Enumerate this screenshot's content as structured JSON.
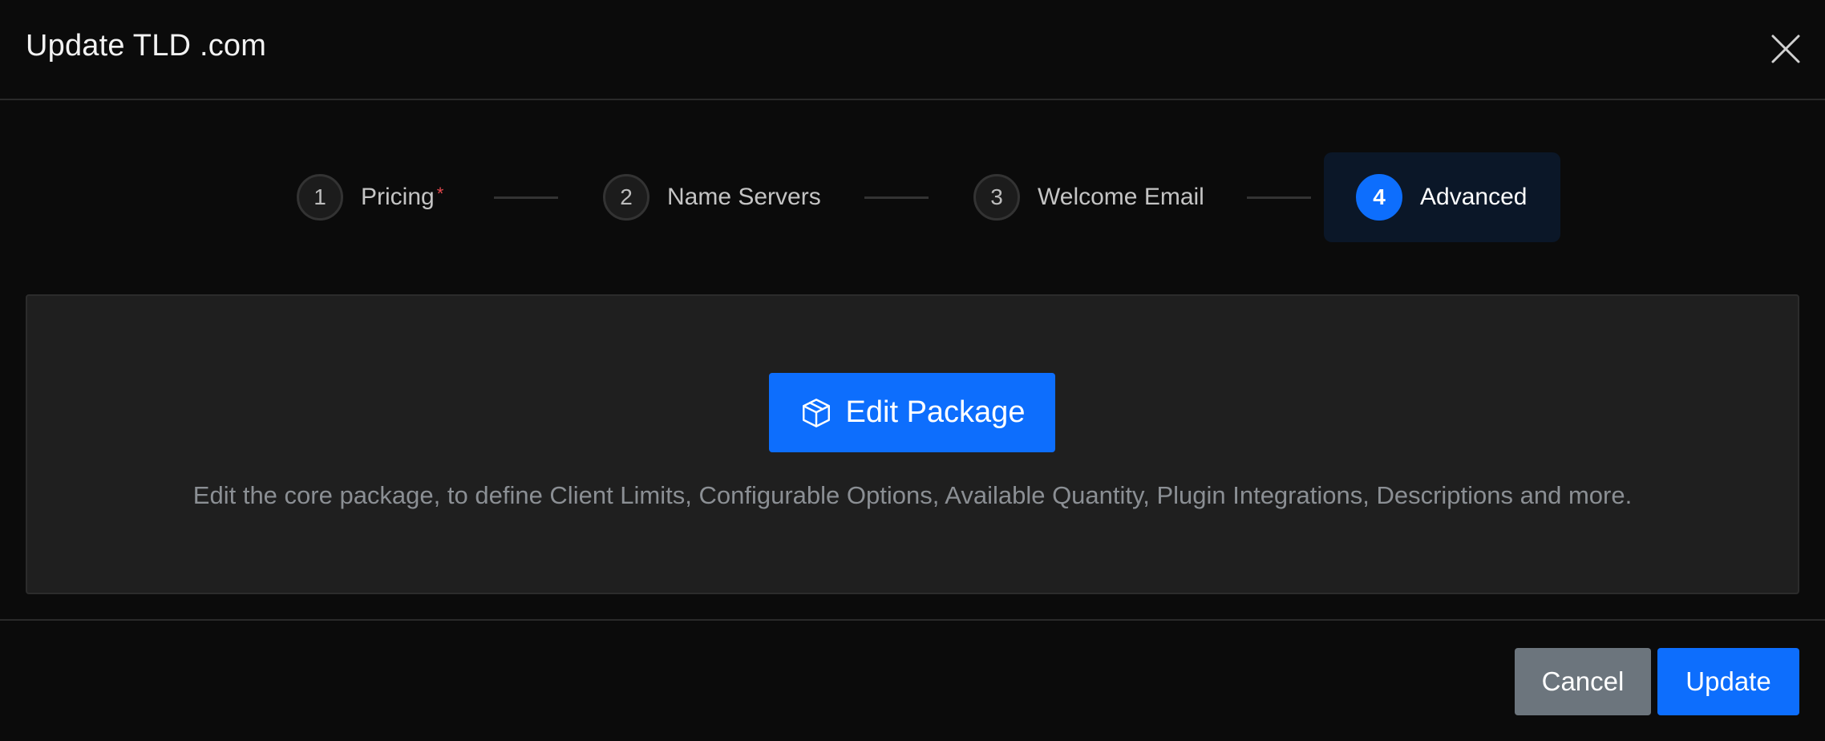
{
  "modal": {
    "title": "Update TLD .com",
    "close_icon": "close-icon"
  },
  "stepper": {
    "steps": [
      {
        "number": "1",
        "label": "Pricing",
        "required_mark": "*",
        "active": false
      },
      {
        "number": "2",
        "label": "Name Servers",
        "active": false
      },
      {
        "number": "3",
        "label": "Welcome Email",
        "active": false
      },
      {
        "number": "4",
        "label": "Advanced",
        "active": true
      }
    ]
  },
  "panel": {
    "button_label": "Edit Package",
    "button_icon": "package-box-icon",
    "description": "Edit the core package, to define Client Limits, Configurable Options, Available Quantity, Plugin Integrations, Descriptions and more."
  },
  "footer": {
    "cancel_label": "Cancel",
    "update_label": "Update"
  },
  "colors": {
    "primary": "#0d6efd",
    "secondary": "#6c757d",
    "background": "#0b0b0b",
    "panel": "#1f1f1f",
    "required": "#e5484d"
  }
}
